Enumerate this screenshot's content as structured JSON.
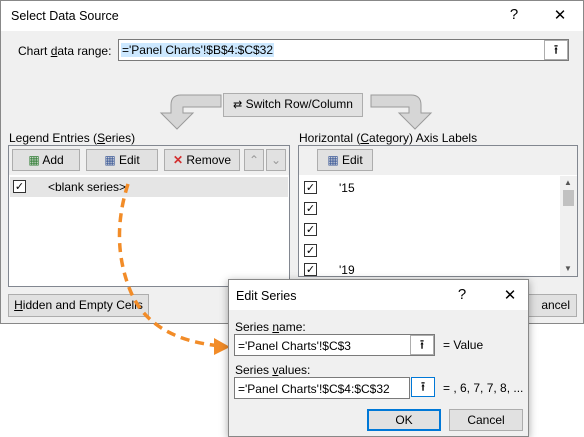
{
  "main_dialog": {
    "title": "Select Data Source",
    "help_icon": "?",
    "close_icon": "✕",
    "chart_range_label": "Chart data range:",
    "chart_range_value": "='Panel Charts'!$B$4:$C$32",
    "switch_button": "Switch Row/Column",
    "legend_label": "Legend Entries (Series)",
    "legend_toolbar": {
      "add": "Add",
      "edit": "Edit",
      "remove": "Remove"
    },
    "series": [
      {
        "label": "<blank series>",
        "checked": true
      }
    ],
    "axis_label": "Horizontal (Category) Axis Labels",
    "axis_edit": "Edit",
    "axis_items": [
      {
        "label": "'15",
        "checked": true
      },
      {
        "label": "",
        "checked": true
      },
      {
        "label": "",
        "checked": true
      },
      {
        "label": "",
        "checked": true
      },
      {
        "label": "'19",
        "checked": true
      }
    ],
    "hidden_cells_button": "Hidden and Empty Cells",
    "cancel_partial": "ancel"
  },
  "edit_series": {
    "title": "Edit Series",
    "help_icon": "?",
    "close_icon": "✕",
    "series_name_label": "Series name:",
    "series_name_value": "='Panel Charts'!$C$3",
    "series_name_preview": "= Value",
    "series_values_label": "Series values:",
    "series_values_value": "='Panel Charts'!$C$4:$C$32",
    "series_values_preview": "= , 6, 7, 7, 8, ...",
    "ok": "OK",
    "cancel": "Cancel"
  },
  "colors": {
    "annotation_arrow": "#f28c28",
    "selection": "#cce8ff",
    "remove_red": "#d32f2f"
  }
}
